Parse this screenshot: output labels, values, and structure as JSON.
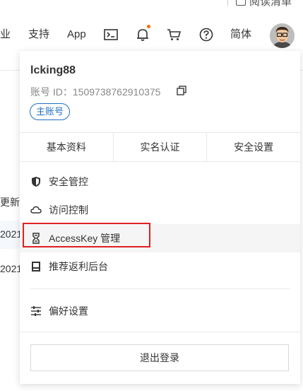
{
  "topbar": {
    "top_fragment": "阅读清单",
    "nav": {
      "industry": "业",
      "support": "支持",
      "app": "App",
      "language": "简体"
    },
    "icons": [
      "terminal-icon",
      "bell-icon",
      "cart-icon",
      "help-icon"
    ],
    "notification_dot_color": "#ff6a00"
  },
  "background": {
    "header_fragment": "更新B",
    "row1": "2021",
    "row2": "2021"
  },
  "dropdown": {
    "username": "lcking88",
    "account_id": "账号 ID：1509738762910375",
    "account_tag": "主账号",
    "tabs": [
      "基本资料",
      "实名认证",
      "安全设置"
    ],
    "menu": [
      {
        "label": "安全管控",
        "icon": "shield-icon"
      },
      {
        "label": "访问控制",
        "icon": "cloud-icon"
      },
      {
        "label": "AccessKey 管理",
        "icon": "key-icon"
      },
      {
        "label": "推荐返利后台",
        "icon": "card-icon"
      },
      {
        "label": "偏好设置",
        "icon": "sliders-icon"
      }
    ],
    "logout": "退出登录"
  },
  "colors": {
    "accent": "#2070c0",
    "highlight": "#e02020"
  }
}
